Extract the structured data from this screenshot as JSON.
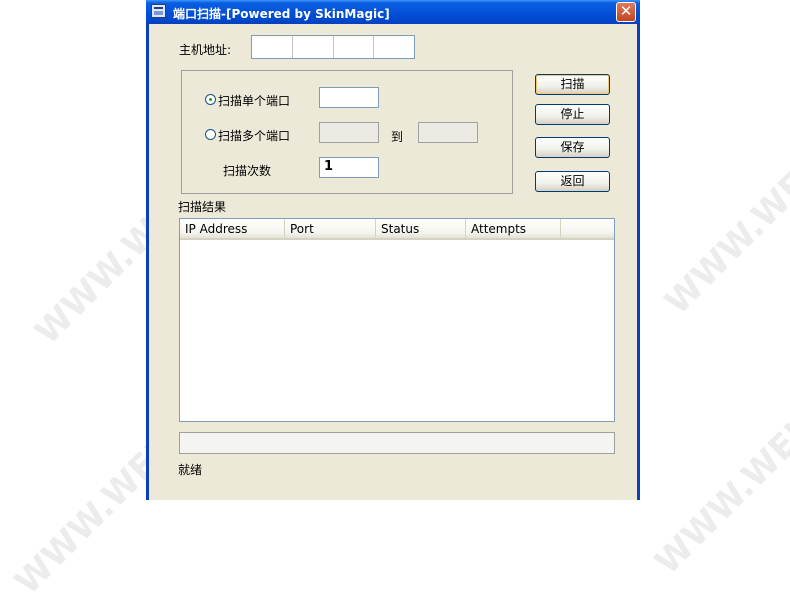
{
  "window": {
    "title": "端口扫描-[Powered by SkinMagic]",
    "close_glyph": "✕"
  },
  "host": {
    "label": "主机地址:",
    "ip_segments": [
      "",
      "",
      "",
      ""
    ]
  },
  "scan_options": {
    "single_port_label": "扫描单个端口",
    "single_port_selected": true,
    "single_port_value": "",
    "multi_port_label": "扫描多个端口",
    "multi_port_selected": false,
    "multi_port_from": "",
    "to_label": "到",
    "multi_port_to": "",
    "scan_count_label": "扫描次数",
    "scan_count_value": "1"
  },
  "buttons": {
    "scan": "扫描",
    "stop": "停止",
    "save": "保存",
    "back": "返回"
  },
  "results": {
    "label": "扫描结果",
    "columns": [
      "IP Address",
      "Port",
      "Status",
      "Attempts"
    ],
    "rows": []
  },
  "progress": {
    "value": 0
  },
  "status_text": "就绪",
  "watermark_text": "WWW.WEIDOWN.COM",
  "colors": {
    "window_bg": "#ece9d8",
    "titlebar": "#0552d8",
    "close_button": "#c24522"
  }
}
